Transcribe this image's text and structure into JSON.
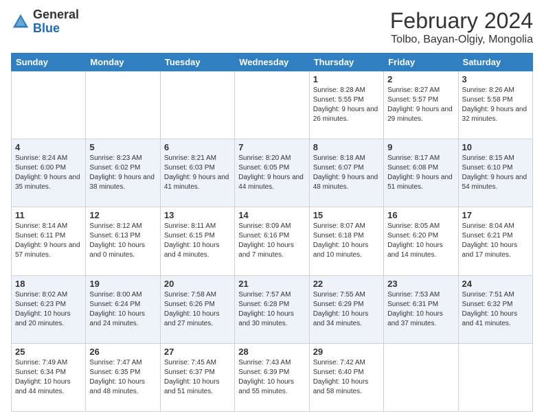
{
  "header": {
    "logo_general": "General",
    "logo_blue": "Blue",
    "month_year": "February 2024",
    "location": "Tolbo, Bayan-Olgiy, Mongolia"
  },
  "weekdays": [
    "Sunday",
    "Monday",
    "Tuesday",
    "Wednesday",
    "Thursday",
    "Friday",
    "Saturday"
  ],
  "weeks": [
    [
      {
        "day": "",
        "info": ""
      },
      {
        "day": "",
        "info": ""
      },
      {
        "day": "",
        "info": ""
      },
      {
        "day": "",
        "info": ""
      },
      {
        "day": "1",
        "info": "Sunrise: 8:28 AM\nSunset: 5:55 PM\nDaylight: 9 hours and 26 minutes."
      },
      {
        "day": "2",
        "info": "Sunrise: 8:27 AM\nSunset: 5:57 PM\nDaylight: 9 hours and 29 minutes."
      },
      {
        "day": "3",
        "info": "Sunrise: 8:26 AM\nSunset: 5:58 PM\nDaylight: 9 hours and 32 minutes."
      }
    ],
    [
      {
        "day": "4",
        "info": "Sunrise: 8:24 AM\nSunset: 6:00 PM\nDaylight: 9 hours and 35 minutes."
      },
      {
        "day": "5",
        "info": "Sunrise: 8:23 AM\nSunset: 6:02 PM\nDaylight: 9 hours and 38 minutes."
      },
      {
        "day": "6",
        "info": "Sunrise: 8:21 AM\nSunset: 6:03 PM\nDaylight: 9 hours and 41 minutes."
      },
      {
        "day": "7",
        "info": "Sunrise: 8:20 AM\nSunset: 6:05 PM\nDaylight: 9 hours and 44 minutes."
      },
      {
        "day": "8",
        "info": "Sunrise: 8:18 AM\nSunset: 6:07 PM\nDaylight: 9 hours and 48 minutes."
      },
      {
        "day": "9",
        "info": "Sunrise: 8:17 AM\nSunset: 6:08 PM\nDaylight: 9 hours and 51 minutes."
      },
      {
        "day": "10",
        "info": "Sunrise: 8:15 AM\nSunset: 6:10 PM\nDaylight: 9 hours and 54 minutes."
      }
    ],
    [
      {
        "day": "11",
        "info": "Sunrise: 8:14 AM\nSunset: 6:11 PM\nDaylight: 9 hours and 57 minutes."
      },
      {
        "day": "12",
        "info": "Sunrise: 8:12 AM\nSunset: 6:13 PM\nDaylight: 10 hours and 0 minutes."
      },
      {
        "day": "13",
        "info": "Sunrise: 8:11 AM\nSunset: 6:15 PM\nDaylight: 10 hours and 4 minutes."
      },
      {
        "day": "14",
        "info": "Sunrise: 8:09 AM\nSunset: 6:16 PM\nDaylight: 10 hours and 7 minutes."
      },
      {
        "day": "15",
        "info": "Sunrise: 8:07 AM\nSunset: 6:18 PM\nDaylight: 10 hours and 10 minutes."
      },
      {
        "day": "16",
        "info": "Sunrise: 8:05 AM\nSunset: 6:20 PM\nDaylight: 10 hours and 14 minutes."
      },
      {
        "day": "17",
        "info": "Sunrise: 8:04 AM\nSunset: 6:21 PM\nDaylight: 10 hours and 17 minutes."
      }
    ],
    [
      {
        "day": "18",
        "info": "Sunrise: 8:02 AM\nSunset: 6:23 PM\nDaylight: 10 hours and 20 minutes."
      },
      {
        "day": "19",
        "info": "Sunrise: 8:00 AM\nSunset: 6:24 PM\nDaylight: 10 hours and 24 minutes."
      },
      {
        "day": "20",
        "info": "Sunrise: 7:58 AM\nSunset: 6:26 PM\nDaylight: 10 hours and 27 minutes."
      },
      {
        "day": "21",
        "info": "Sunrise: 7:57 AM\nSunset: 6:28 PM\nDaylight: 10 hours and 30 minutes."
      },
      {
        "day": "22",
        "info": "Sunrise: 7:55 AM\nSunset: 6:29 PM\nDaylight: 10 hours and 34 minutes."
      },
      {
        "day": "23",
        "info": "Sunrise: 7:53 AM\nSunset: 6:31 PM\nDaylight: 10 hours and 37 minutes."
      },
      {
        "day": "24",
        "info": "Sunrise: 7:51 AM\nSunset: 6:32 PM\nDaylight: 10 hours and 41 minutes."
      }
    ],
    [
      {
        "day": "25",
        "info": "Sunrise: 7:49 AM\nSunset: 6:34 PM\nDaylight: 10 hours and 44 minutes."
      },
      {
        "day": "26",
        "info": "Sunrise: 7:47 AM\nSunset: 6:35 PM\nDaylight: 10 hours and 48 minutes."
      },
      {
        "day": "27",
        "info": "Sunrise: 7:45 AM\nSunset: 6:37 PM\nDaylight: 10 hours and 51 minutes."
      },
      {
        "day": "28",
        "info": "Sunrise: 7:43 AM\nSunset: 6:39 PM\nDaylight: 10 hours and 55 minutes."
      },
      {
        "day": "29",
        "info": "Sunrise: 7:42 AM\nSunset: 6:40 PM\nDaylight: 10 hours and 58 minutes."
      },
      {
        "day": "",
        "info": ""
      },
      {
        "day": "",
        "info": ""
      }
    ]
  ]
}
